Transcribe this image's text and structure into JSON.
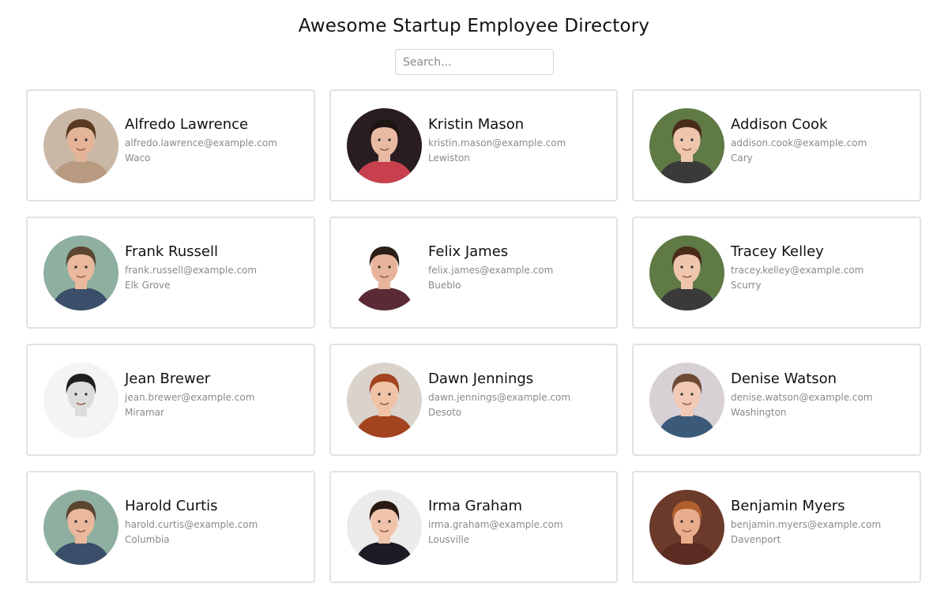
{
  "header": {
    "title": "Awesome Startup Employee Directory"
  },
  "search": {
    "placeholder": "Search...",
    "value": ""
  },
  "employees": [
    {
      "name": "Alfredo Lawrence",
      "email": "alfredo.lawrence@example.com",
      "city": "Waco",
      "avatar": {
        "bg": "#c9b8a6",
        "skin": "#e3b497",
        "hair": "#5a3a22",
        "shirt": "#b89a80"
      }
    },
    {
      "name": "Kristin Mason",
      "email": "kristin.mason@example.com",
      "city": "Lewiston",
      "avatar": {
        "bg": "#2a1d22",
        "skin": "#e8b9a3",
        "hair": "#1e1412",
        "shirt": "#c8404e"
      }
    },
    {
      "name": "Addison Cook",
      "email": "addison.cook@example.com",
      "city": "Cary",
      "avatar": {
        "bg": "#5f7a45",
        "skin": "#efc6ad",
        "hair": "#4a2c1a",
        "shirt": "#3a3a3a"
      }
    },
    {
      "name": "Frank Russell",
      "email": "frank.russell@example.com",
      "city": "Elk Grove",
      "avatar": {
        "bg": "#8fb0a0",
        "skin": "#eab89c",
        "hair": "#5b4530",
        "shirt": "#3b4f6a"
      }
    },
    {
      "name": "Felix James",
      "email": "felix.james@example.com",
      "city": "Bueblo",
      "avatar": {
        "bg": "#ffffff",
        "skin": "#e7b49b",
        "hair": "#2b1e16",
        "shirt": "#5a2b36"
      }
    },
    {
      "name": "Tracey Kelley",
      "email": "tracey.kelley@example.com",
      "city": "Scurry",
      "avatar": {
        "bg": "#5f7a45",
        "skin": "#efc6ad",
        "hair": "#4a2c1a",
        "shirt": "#3a3a3a"
      }
    },
    {
      "name": "Jean Brewer",
      "email": "jean.brewer@example.com",
      "city": "Miramar",
      "avatar": {
        "bg": "#f4f4f4",
        "skin": "#dcdcdc",
        "hair": "#1f1f1f",
        "shirt": "#f4f4f4"
      }
    },
    {
      "name": "Dawn Jennings",
      "email": "dawn.jennings@example.com",
      "city": "Desoto",
      "avatar": {
        "bg": "#d9d3cc",
        "skin": "#f0c2a6",
        "hair": "#a3431f",
        "shirt": "#a3431f"
      }
    },
    {
      "name": "Denise Watson",
      "email": "denise.watson@example.com",
      "city": "Washington",
      "avatar": {
        "bg": "#d7d0d4",
        "skin": "#f1c9b4",
        "hair": "#6e4a33",
        "shirt": "#3b5a7a"
      }
    },
    {
      "name": "Harold Curtis",
      "email": "harold.curtis@example.com",
      "city": "Columbia",
      "avatar": {
        "bg": "#8fb0a0",
        "skin": "#eab89c",
        "hair": "#5b4530",
        "shirt": "#3b4f6a"
      }
    },
    {
      "name": "Irma Graham",
      "email": "irma.graham@example.com",
      "city": "Lousville",
      "avatar": {
        "bg": "#ecebea",
        "skin": "#f0c4aa",
        "hair": "#2a1a14",
        "shirt": "#1c1c24"
      }
    },
    {
      "name": "Benjamin Myers",
      "email": "benjamin.myers@example.com",
      "city": "Davenport",
      "avatar": {
        "bg": "#6b3a2a",
        "skin": "#e9ad8e",
        "hair": "#b0602c",
        "shirt": "#5a2c22"
      }
    }
  ]
}
